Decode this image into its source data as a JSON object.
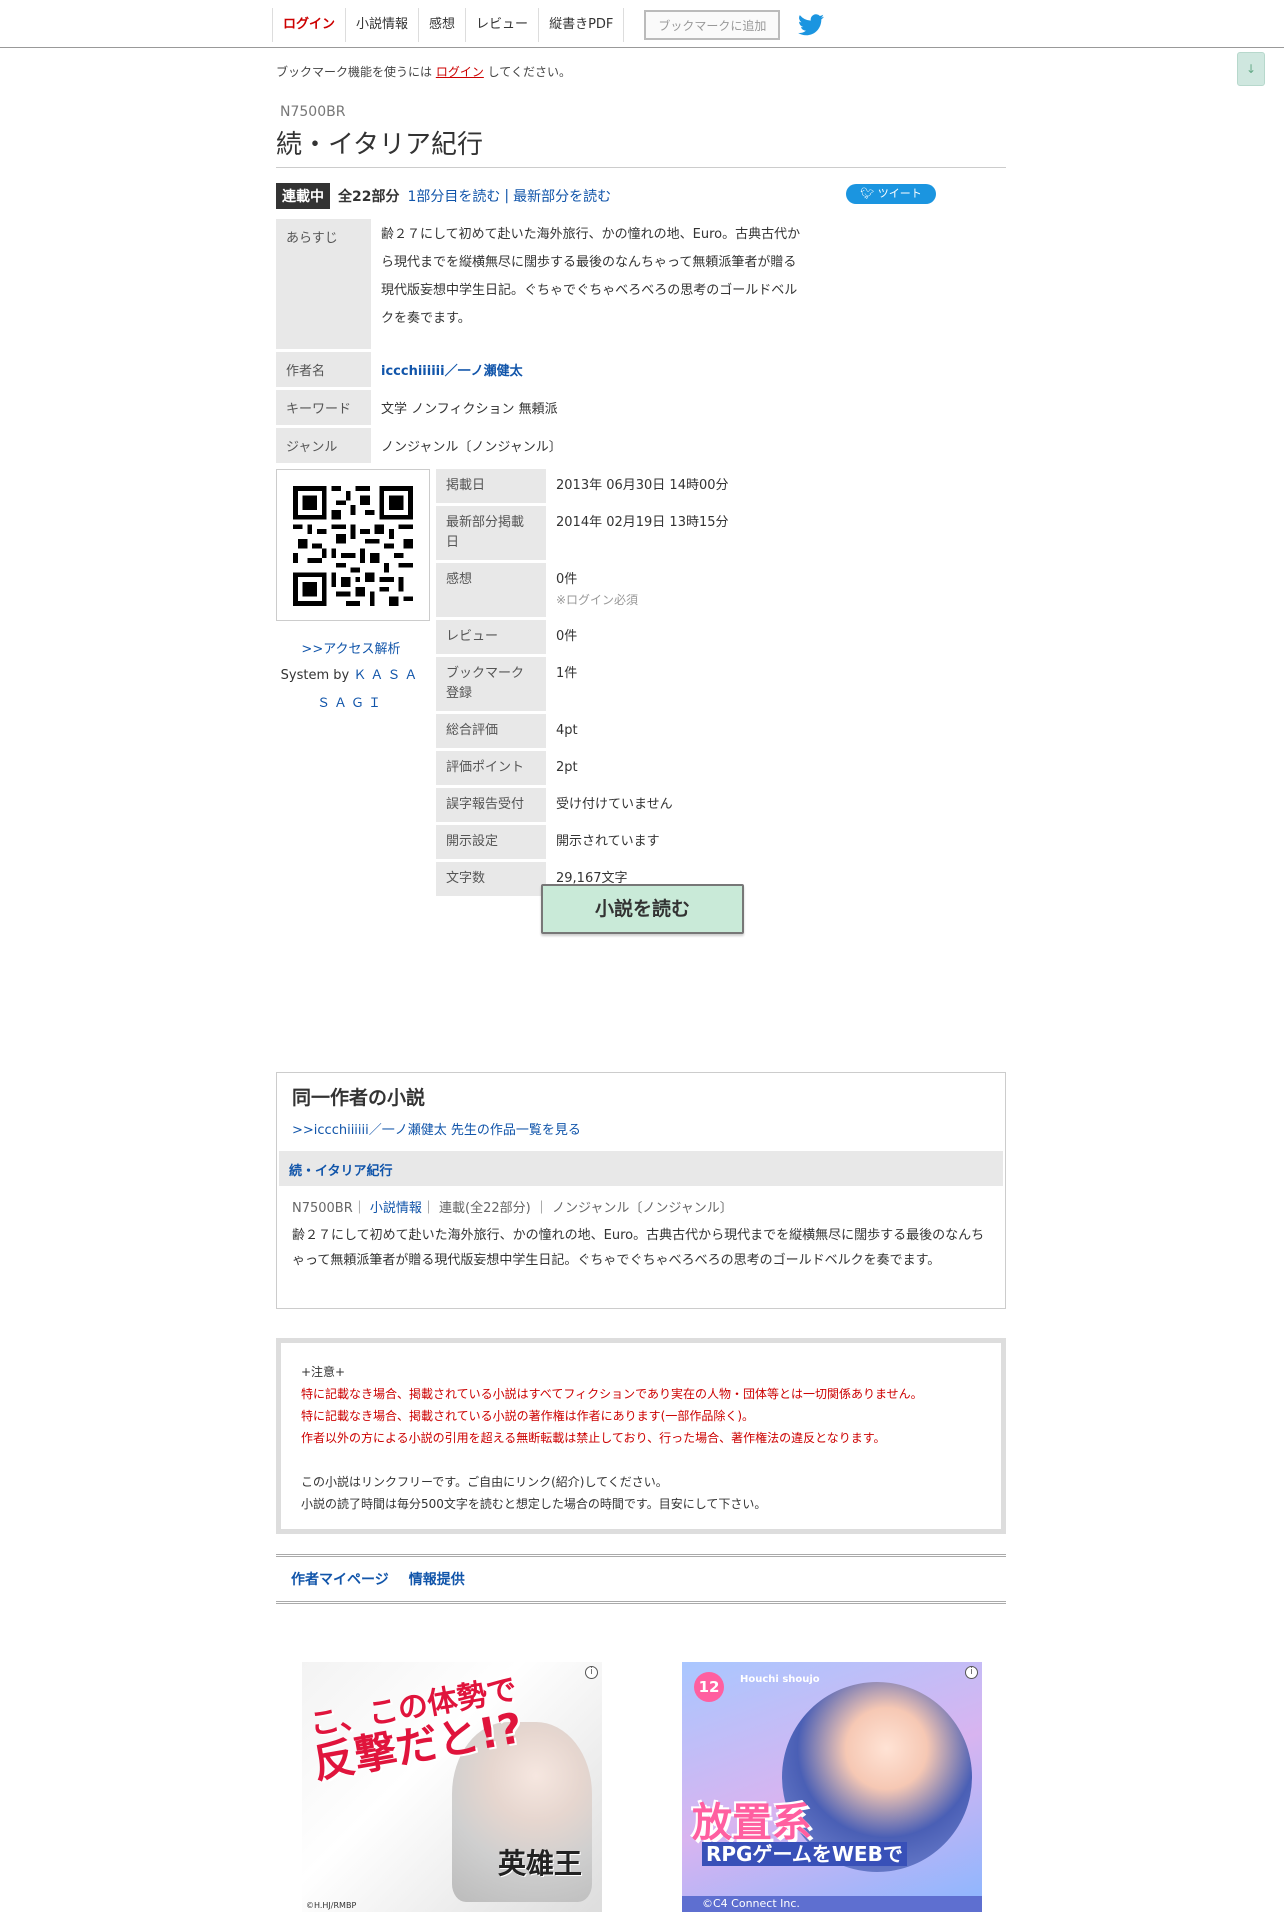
{
  "nav": {
    "login": "ログイン",
    "novel_info": "小説情報",
    "impressions": "感想",
    "review": "レビュー",
    "vertical_pdf": "縦書きPDF",
    "add_bookmark": "ブックマークに追加"
  },
  "scroll_arrow": "↓",
  "login_note": {
    "before": "ブックマーク機能を使うには ",
    "link": "ログイン",
    "after": " してください。"
  },
  "novel": {
    "ncode": "N7500BR",
    "title": "続・イタリア紀行",
    "status": "連載中",
    "total_parts": "全22部分",
    "read_first": "1部分目を読む",
    "separator": "|",
    "read_latest": "最新部分を読む",
    "tweet": "ツイート"
  },
  "info_main": {
    "synopsis_label": "あらすじ",
    "synopsis": "齢２７にして初めて赴いた海外旅行、かの憧れの地、Euro。古典古代から現代までを縦横無尽に闊歩する最後のなんちゃって無頼派筆者が贈る現代版妄想中学生日記。ぐちゃでぐちゃべろべろの思考のゴールドベルクを奏でます。",
    "author_label": "作者名",
    "author": "iccchiiiiii／一ノ瀬健太",
    "keyword_label": "キーワード",
    "keywords": "文学 ノンフィクション 無頼派",
    "genre_label": "ジャンル",
    "genre": "ノンジャンル〔ノンジャンル〕"
  },
  "side": {
    "access_link": ">>アクセス解析",
    "system_by": "System by ",
    "system_name": "ＫＡＳＡＳＡＧＩ"
  },
  "info_sub": {
    "published_label": "掲載日",
    "published": "2013年 06月30日 14時00分",
    "latest_label": "最新部分掲載日",
    "latest": "2014年 02月19日 13時15分",
    "impressions_label": "感想",
    "impressions": "0件",
    "impressions_note": "※ログイン必須",
    "review_label": "レビュー",
    "review": "0件",
    "bookmark_label": "ブックマーク登録",
    "bookmark": "1件",
    "total_label": "総合評価",
    "total": "4pt",
    "points_label": "評価ポイント",
    "points": "2pt",
    "typo_label": "誤字報告受付",
    "typo": "受け付けていません",
    "disclosure_label": "開示設定",
    "disclosure": "開示されています",
    "chars_label": "文字数",
    "chars": "29,167文字"
  },
  "read_button": "小説を読む",
  "same_author": {
    "heading": "同一作者の小説",
    "list_link": ">>iccchiiiiii／一ノ瀬健太 先生の作品一覧を見る",
    "item_title": "続・イタリア紀行",
    "meta_code": "N7500BR｜ ",
    "meta_info_link": "小説情報",
    "meta_rest": "｜ 連載(全22部分) ｜ ノンジャンル〔ノンジャンル〕",
    "description": "齢２７にして初めて赴いた海外旅行、かの憧れの地、Euro。古典古代から現代までを縦横無尽に闊歩する最後のなんちゃって無頼派筆者が贈る現代版妄想中学生日記。ぐちゃでぐちゃべろべろの思考のゴールドベルクを奏でます。"
  },
  "notice": {
    "heading": "+注意+",
    "line1": "特に記載なき場合、掲載されている小説はすべてフィクションであり実在の人物・団体等とは一切関係ありません。",
    "line2": "特に記載なき場合、掲載されている小説の著作権は作者にあります(一部作品除く)。",
    "line3": "作者以外の方による小説の引用を超える無断転載は禁止しており、行った場合、著作権法の違反となります。",
    "line4": "この小説はリンクフリーです。ご自由にリンク(紹介)してください。",
    "line5": "小説の読了時間は毎分500文字を読むと想定した場合の時間です。目安にして下さい。"
  },
  "footer": {
    "mypage": "作者マイページ",
    "report": "情報提供"
  },
  "ads": {
    "ad1_line1": "こ、この体勢で",
    "ad1_line2": "反撃だと!?",
    "ad1_logo": "英雄王",
    "ad1_copy": "©H.HJ/RMBP",
    "ad2_badge": "12",
    "ad2_small": "Houchi shoujo",
    "ad2_big": "放置系",
    "ad2_sub": "RPGゲームをWEBで",
    "ad2_copy": "©C4 Connect Inc.",
    "info": "i"
  },
  "colors": {
    "link": "#1155aa",
    "login_red": "#cc0000",
    "status_badge": "#333333",
    "read_button_bg": "#c9ead8",
    "twitter_blue": "#1b95e0"
  }
}
